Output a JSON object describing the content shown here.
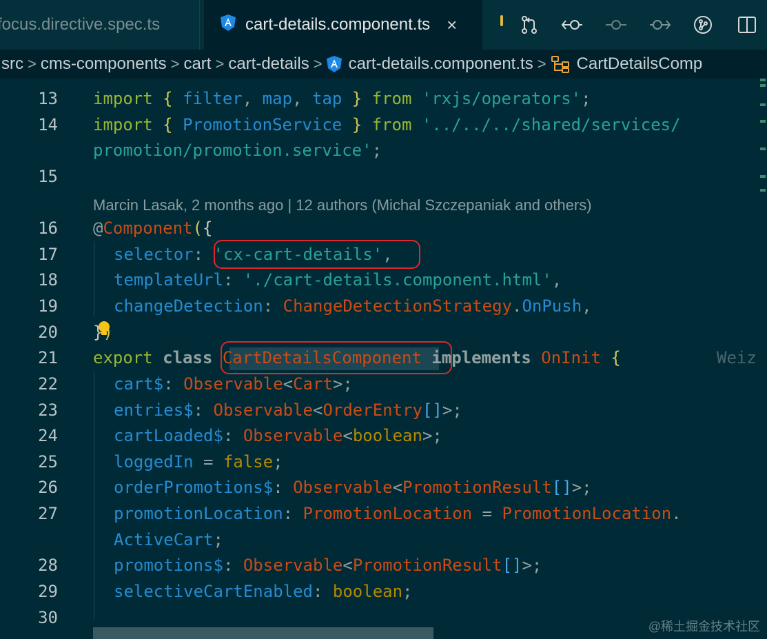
{
  "tabs": {
    "inactive_label": "focus.directive.spec.ts",
    "active_label": "cart-details.component.ts",
    "close_glyph": "×"
  },
  "breadcrumb": {
    "items": [
      "src",
      "cms-components",
      "cart",
      "cart-details",
      "cart-details.component.ts",
      "CartDetailsComp"
    ],
    "separator": ">"
  },
  "editor": {
    "line_numbers": [
      "13",
      "14",
      "15",
      "16",
      "17",
      "18",
      "19",
      "20",
      "21",
      "22",
      "23",
      "24",
      "25",
      "26",
      "27",
      "28",
      "29",
      "30"
    ],
    "code_lens": "Marcin Lasak, 2 months ago | 12 authors (Michal Szczepaniak and others)",
    "ghost_text": "Weiz",
    "lines": {
      "l13": {
        "kw": "import",
        "b1": " { ",
        "a": "filter",
        "c1": ", ",
        "b": "map",
        "c2": ", ",
        "c": "tap",
        "b2": " } ",
        "from": "from",
        "sp": " ",
        "str": "'rxjs/operators'",
        "end": ";"
      },
      "l14": {
        "kw": "import",
        "b1": " { ",
        "a": "PromotionService",
        "b2": " } ",
        "from": "from",
        "sp": " ",
        "str1": "'../../../shared/services/",
        "str2": "promotion/promotion.service'",
        "end": ";"
      },
      "l16": {
        "at": "@",
        "dec": "Component",
        "p": "(",
        "b": "{"
      },
      "l17": {
        "key": "selector",
        "colon": ": ",
        "str": "'cx-cart-details'",
        "end": ","
      },
      "l18": {
        "key": "templateUrl",
        "colon": ": ",
        "str": "'./cart-details.component.html'",
        "end": ","
      },
      "l19": {
        "key": "changeDetection",
        "colon": ": ",
        "type": "ChangeDetectionStrategy",
        "dot": ".",
        "prop": "OnPush",
        "end": ","
      },
      "l20": {
        "b": "}",
        "p": ")"
      },
      "l21": {
        "kw": "export",
        "sp1": " ",
        "cls": "class",
        "sp2": " ",
        "name": "CartDetailsComponent",
        "sp3": " ",
        "impl": "implements",
        "sp4": " ",
        "iface": "OnInit",
        "sp5": " ",
        "b": "{"
      },
      "l22": {
        "prop": "cart$",
        "colon": ": ",
        "type": "Observable",
        "lt": "<",
        "arg": "Cart",
        "gt": ">",
        "end": ";"
      },
      "l23": {
        "prop": "entries$",
        "colon": ": ",
        "type": "Observable",
        "lt": "<",
        "arg": "OrderEntry",
        "arr": "[]",
        "gt": ">",
        "end": ";"
      },
      "l24": {
        "prop": "cartLoaded$",
        "colon": ": ",
        "type": "Observable",
        "lt": "<",
        "arg": "boolean",
        "gt": ">",
        "end": ";"
      },
      "l25": {
        "prop": "loggedIn",
        "eq": " = ",
        "val": "false",
        "end": ";"
      },
      "l26": {
        "prop": "orderPromotions$",
        "colon": ": ",
        "type": "Observable",
        "lt": "<",
        "arg": "PromotionResult",
        "arr": "[]",
        "gt": ">",
        "end": ";"
      },
      "l27": {
        "prop": "promotionLocation",
        "colon": ": ",
        "type": "PromotionLocation",
        "eq": " = ",
        "type2": "PromotionLocation",
        "dot": ".",
        "cont": "ActiveCart",
        "end": ";"
      },
      "l28": {
        "prop": "promotions$",
        "colon": ": ",
        "type": "Observable",
        "lt": "<",
        "arg": "PromotionResult",
        "arr": "[]",
        "gt": ">",
        "end": ";"
      },
      "l29": {
        "prop": "selectiveCartEnabled",
        "colon": ": ",
        "arg": "boolean",
        "end": ";"
      }
    }
  },
  "watermark": "@稀土掘金技术社区",
  "colors": {
    "background": "#002b36",
    "highlight_box": "#e0262a",
    "angular_icon": "#1e88e5"
  },
  "icons": [
    "angular-icon",
    "close-icon",
    "source-control-icon",
    "go-back-icon",
    "commit-icon",
    "go-forward-icon",
    "git-graph-icon",
    "split-editor-icon",
    "symbol-class-icon",
    "lightbulb-icon"
  ]
}
